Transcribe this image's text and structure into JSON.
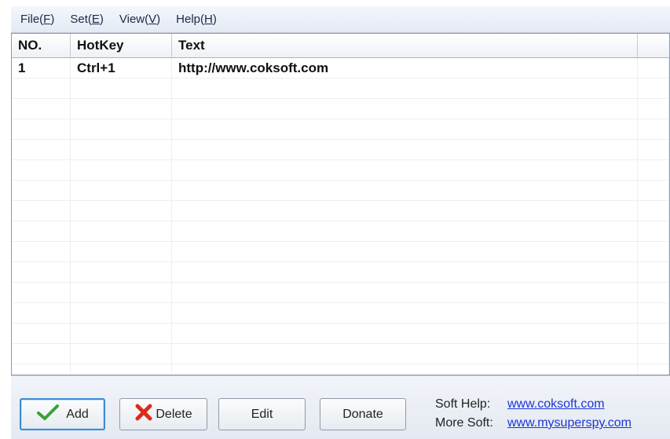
{
  "menu": [
    {
      "label": "File(F)",
      "base": "File(",
      "mnemonic": "F",
      "tail": ")"
    },
    {
      "label": "Set(E)",
      "base": "Set(",
      "mnemonic": "E",
      "tail": ")"
    },
    {
      "label": "View(V)",
      "base": "View(",
      "mnemonic": "V",
      "tail": ")"
    },
    {
      "label": "Help(H)",
      "base": "Help(",
      "mnemonic": "H",
      "tail": ")"
    }
  ],
  "table": {
    "columns": [
      "NO.",
      "HotKey",
      "Text"
    ],
    "rows": [
      {
        "no": "1",
        "hotkey": "Ctrl+1",
        "text": "http://www.coksoft.com"
      }
    ],
    "empty_rows": 16
  },
  "buttons": {
    "add": "Add",
    "delete": "Delete",
    "edit": "Edit",
    "donate": "Donate"
  },
  "links": {
    "soft_help_label": "Soft Help:",
    "soft_help_url": "www.coksoft.com",
    "more_soft_label": "More Soft:",
    "more_soft_url": "www.mysuperspy.com"
  },
  "colors": {
    "link": "#1b36d4",
    "add_icon": "#3aa335",
    "delete_icon": "#e02a1a",
    "focus_border": "#3d8ad6"
  }
}
